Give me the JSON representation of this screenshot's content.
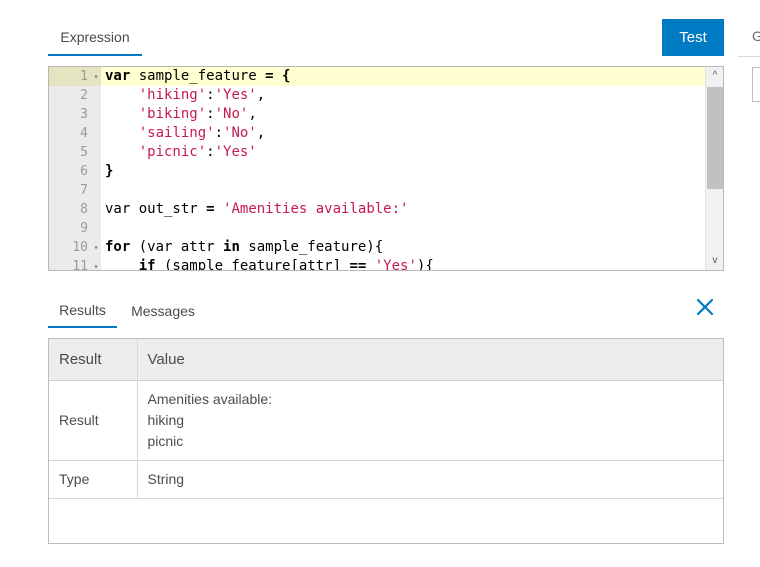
{
  "top": {
    "expression_tab": "Expression",
    "test_button": "Test",
    "right_tab_partial": "G"
  },
  "editor": {
    "active_line": 1,
    "lines": [
      {
        "n": "1",
        "fold": true
      },
      {
        "n": "2"
      },
      {
        "n": "3"
      },
      {
        "n": "4"
      },
      {
        "n": "5"
      },
      {
        "n": "6"
      },
      {
        "n": "7"
      },
      {
        "n": "8"
      },
      {
        "n": "9"
      },
      {
        "n": "10",
        "fold": true
      },
      {
        "n": "11",
        "fold": true
      }
    ],
    "code": [
      "var sample_feature = {",
      "    'hiking':'Yes',",
      "    'biking':'No',",
      "    'sailing':'No',",
      "    'picnic':'Yes'",
      "}",
      "",
      "var out_str = 'Amenities available:'",
      "",
      "for (var attr in sample_feature){",
      "    if (sample_feature[attr] == 'Yes'){"
    ]
  },
  "results": {
    "tab_results": "Results",
    "tab_messages": "Messages",
    "header_result": "Result",
    "header_value": "Value",
    "rows": [
      {
        "label": "Result",
        "values": [
          "Amenities available:",
          "hiking",
          "picnic"
        ]
      },
      {
        "label": "Type",
        "values": [
          "String"
        ]
      }
    ]
  },
  "colors": {
    "accent": "#007ac2",
    "string": "#c41a4c",
    "active_line": "#ffffd2"
  }
}
